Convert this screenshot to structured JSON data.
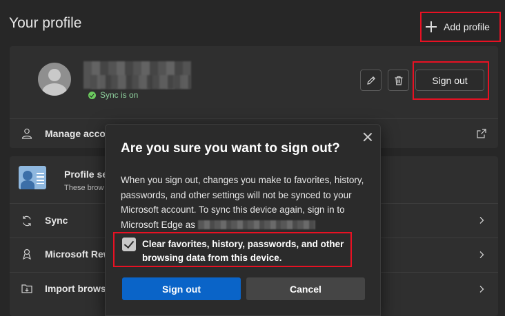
{
  "page": {
    "title": "Your profile",
    "add_profile_label": "Add profile"
  },
  "profile": {
    "sync_status": "Sync is on",
    "sign_out_label": "Sign out",
    "manage_account_label": "Manage accou"
  },
  "settings": {
    "profile_settings_title": "Profile se",
    "profile_settings_sub": "These brow",
    "sync_label": "Sync",
    "rewards_label": "Microsoft Rew",
    "import_label": "Import brows"
  },
  "dialog": {
    "title": "Are you sure you want to sign out?",
    "body": "When you sign out, changes you make to favorites, history, passwords, and other settings will not be synced to your Microsoft account. To sync this device again, sign in to Microsoft Edge as",
    "checkbox_label": "Clear favorites, history, passwords, and other browsing data from this device.",
    "checkbox_checked": true,
    "sign_out_button": "Sign out",
    "cancel_button": "Cancel"
  },
  "colors": {
    "background": "#272727",
    "card": "#2f2f2f",
    "accent_blue": "#0a64c8",
    "highlight_red": "#e81123",
    "sync_green": "#6ccb5f"
  },
  "icons": [
    "plus-icon",
    "pencil-icon",
    "trash-icon",
    "person-icon",
    "external-link-icon",
    "sync-icon",
    "trophy-icon",
    "import-icon",
    "chevron-right-icon",
    "close-icon",
    "checkmark-icon"
  ]
}
